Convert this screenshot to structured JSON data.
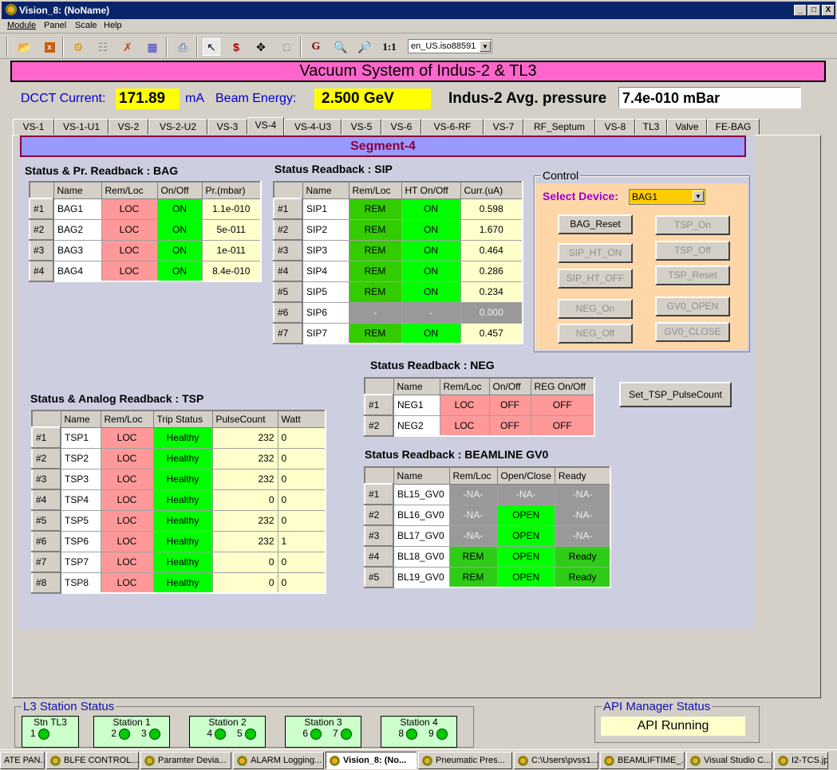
{
  "window": {
    "title": "Vision_8: (NoName)",
    "controls": {
      "minimize": "_",
      "maximize": "□",
      "close": "X"
    }
  },
  "menu": [
    "Module",
    "Panel",
    "Scale",
    "Help"
  ],
  "toolbar": {
    "icons": [
      "open-folder-icon",
      "close-icon",
      "run-panel-icon",
      "tree-icon",
      "tools-icon",
      "hierarchy-icon",
      "print-icon",
      "pointer-icon",
      "stop-icon",
      "move-icon",
      "rectangle-icon",
      "g-icon",
      "zoom-in-icon",
      "zoom-out-icon"
    ],
    "zoom_reset_label": "1:1",
    "language": "en_US.iso88591"
  },
  "header": {
    "title": "Vacuum System  of Indus-2 & TL3",
    "dcct_label": "DCCT Current:",
    "dcct_value": "171.89",
    "dcct_unit": "mA",
    "energy_label": "Beam Energy:",
    "energy_value": "2.500  GeV",
    "pressure_label": "Indus-2 Avg. pressure",
    "pressure_value": "7.4e-010 mBar"
  },
  "tabs": [
    "VS-1",
    "VS-1-U1",
    "VS-2",
    "VS-2-U2",
    "VS-3",
    "VS-4",
    "VS-4-U3",
    "VS-5",
    "VS-6",
    "VS-6-RF",
    "VS-7",
    "RF_Septum",
    "VS-8",
    "TL3",
    "Valve",
    "FE-BAG"
  ],
  "active_tab": "VS-4",
  "segment_title": "Segment-4",
  "bag": {
    "title": "Status & Pr. Readback : BAG",
    "headers": [
      "",
      "Name",
      "Rem/Loc",
      "On/Off",
      "Pr.(mbar)"
    ],
    "rows": [
      [
        "#1",
        "BAG1",
        "LOC",
        "ON",
        "1.1e-010"
      ],
      [
        "#2",
        "BAG2",
        "LOC",
        "ON",
        "5e-011"
      ],
      [
        "#3",
        "BAG3",
        "LOC",
        "ON",
        "1e-011"
      ],
      [
        "#4",
        "BAG4",
        "LOC",
        "ON",
        "8.4e-010"
      ]
    ]
  },
  "sip": {
    "title": "Status Readback : SIP",
    "headers": [
      "",
      "Name",
      "Rem/Loc",
      "HT  On/Off",
      "Curr.(uA)"
    ],
    "rows": [
      [
        "#1",
        "SIP1",
        "REM",
        "ON",
        "0.598"
      ],
      [
        "#2",
        "SIP2",
        "REM",
        "ON",
        "1.670"
      ],
      [
        "#3",
        "SIP3",
        "REM",
        "ON",
        "0.464"
      ],
      [
        "#4",
        "SIP4",
        "REM",
        "ON",
        "0.286"
      ],
      [
        "#5",
        "SIP5",
        "REM",
        "ON",
        "0.234"
      ],
      [
        "#6",
        "SIP6",
        "-",
        "-",
        "0.000"
      ],
      [
        "#7",
        "SIP7",
        "REM",
        "ON",
        "0.457"
      ]
    ]
  },
  "control": {
    "legend": "Control",
    "select_label": "Select Device:",
    "selected_device": "BAG1",
    "buttons": {
      "bag_reset": "BAG_Reset",
      "tsp_on": "TSP_On",
      "sip_ht_on": "SIP_HT_ON",
      "tsp_off": "TSP_Off",
      "sip_ht_off": "SIP_HT_OFF",
      "tsp_reset": "TSP_Reset",
      "neg_on": "NEG_On",
      "gv0_open": "GV0_OPEN",
      "neg_off": "NEG_Off",
      "gv0_close": "GV0_CLOSE"
    }
  },
  "tsp": {
    "title": "Status & Analog Readback : TSP",
    "headers": [
      "",
      "Name",
      "Rem/Loc",
      "Trip Status",
      "PulseCount",
      "Watt"
    ],
    "rows": [
      [
        "#1",
        "TSP1",
        "LOC",
        "Healthy",
        "232",
        "0"
      ],
      [
        "#2",
        "TSP2",
        "LOC",
        "Healthy",
        "232",
        "0"
      ],
      [
        "#3",
        "TSP3",
        "LOC",
        "Healthy",
        "232",
        "0"
      ],
      [
        "#4",
        "TSP4",
        "LOC",
        "Healthy",
        "0",
        "0"
      ],
      [
        "#5",
        "TSP5",
        "LOC",
        "Healthy",
        "232",
        "0"
      ],
      [
        "#6",
        "TSP6",
        "LOC",
        "Healthy",
        "232",
        "1"
      ],
      [
        "#7",
        "TSP7",
        "LOC",
        "Healthy",
        "0",
        "0"
      ],
      [
        "#8",
        "TSP8",
        "LOC",
        "Healthy",
        "0",
        "0"
      ]
    ]
  },
  "neg": {
    "title": "Status Readback : NEG",
    "headers": [
      "",
      "Name",
      "Rem/Loc",
      "On/Off",
      "REG  On/Off"
    ],
    "rows": [
      [
        "#1",
        "NEG1",
        "LOC",
        "OFF",
        "OFF"
      ],
      [
        "#2",
        "NEG2",
        "LOC",
        "OFF",
        "OFF"
      ]
    ]
  },
  "set_tsp_button": "Set_TSP_PulseCount",
  "gv0": {
    "title": "Status Readback : BEAMLINE GV0",
    "headers": [
      "",
      "Name",
      "Rem/Loc",
      "Open/Close",
      "Ready"
    ],
    "rows": [
      [
        "#1",
        "BL15_GV0",
        "-NA-",
        "-NA-",
        "-NA-"
      ],
      [
        "#2",
        "BL16_GV0",
        "-NA-",
        "OPEN",
        "-NA-"
      ],
      [
        "#3",
        "BL17_GV0",
        "-NA-",
        "OPEN",
        "-NA-"
      ],
      [
        "#4",
        "BL18_GV0",
        "REM",
        "OPEN",
        "Ready"
      ],
      [
        "#5",
        "BL19_GV0",
        "REM",
        "OPEN",
        "Ready"
      ]
    ]
  },
  "l3_station": {
    "legend": "L3 Station Status",
    "stations": [
      {
        "name": "Stn TL3",
        "leds": [
          "1"
        ]
      },
      {
        "name": "Station 1",
        "leds": [
          "2",
          "3"
        ]
      },
      {
        "name": "Station 2",
        "leds": [
          "4",
          "5"
        ]
      },
      {
        "name": "Station 3",
        "leds": [
          "6",
          "7"
        ]
      },
      {
        "name": "Station 4",
        "leds": [
          "8",
          "9"
        ]
      }
    ]
  },
  "api_manager": {
    "legend": "API Manager Status",
    "status": "API Running"
  },
  "taskbar": [
    {
      "label": "ATE PAN...",
      "active": false
    },
    {
      "label": "BLFE CONTROL...",
      "active": false
    },
    {
      "label": "Paramter Devia...",
      "active": false
    },
    {
      "label": "ALARM Logging...",
      "active": false
    },
    {
      "label": "Vision_8: (No...",
      "active": true
    },
    {
      "label": "Pneumatic Pres...",
      "active": false
    },
    {
      "label": "C:\\Users\\pvss1...",
      "active": false
    },
    {
      "label": "BEAMLIFTIME_...",
      "active": false
    },
    {
      "label": "Visual Studio C...",
      "active": false
    },
    {
      "label": "I2-TCS.jp",
      "active": false
    }
  ],
  "colors": {
    "banner": "#ff66cc",
    "segment": "#9999ff",
    "loc_red": "#ff9999",
    "on_green": "#00ff00",
    "rem_green": "#33cc00",
    "value_cream": "#ffffcc",
    "na_gray": "#999999",
    "control_bg": "#ffd6a8",
    "highlight_yellow": "#ffff00"
  }
}
